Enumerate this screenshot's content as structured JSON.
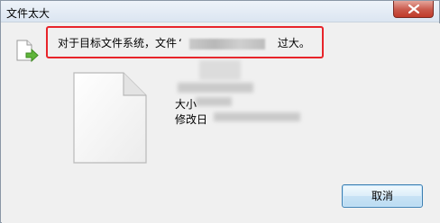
{
  "window": {
    "title": "文件太大"
  },
  "message": {
    "prefix": "对于目标文件系统，文件",
    "open_quote": "‘",
    "suffix": "过大。"
  },
  "details": {
    "size_label": "大小",
    "date_label": "修改日"
  },
  "buttons": {
    "cancel": "取消"
  },
  "colors": {
    "highlight": "#e8242a",
    "close_button": "#c9584a"
  }
}
